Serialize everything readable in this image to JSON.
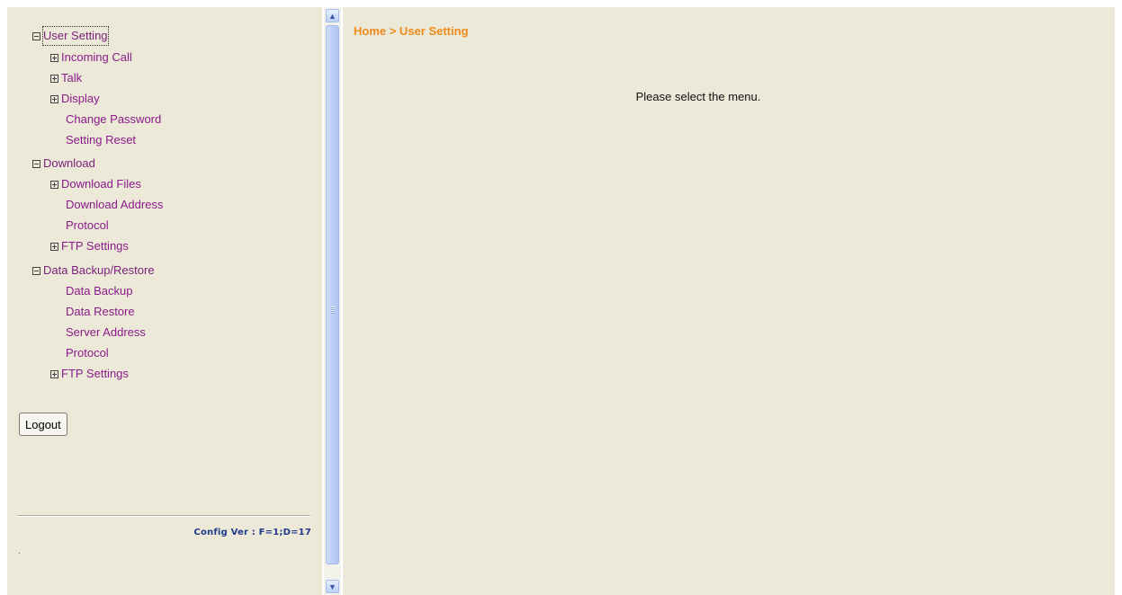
{
  "sidebar": {
    "tree": [
      {
        "label": "User Setting",
        "expander": "minus",
        "level": 0,
        "focused": true
      },
      {
        "label": "Incoming Call",
        "expander": "plus",
        "level": 1
      },
      {
        "label": "Talk",
        "expander": "plus",
        "level": 1
      },
      {
        "label": "Display",
        "expander": "plus",
        "level": 1
      },
      {
        "label": "Change Password",
        "expander": "none",
        "level": 1
      },
      {
        "label": "Setting Reset",
        "expander": "none",
        "level": 1
      },
      {
        "label": "Download",
        "expander": "minus",
        "level": 0
      },
      {
        "label": "Download Files",
        "expander": "plus",
        "level": 1
      },
      {
        "label": "Download Address",
        "expander": "none",
        "level": 1
      },
      {
        "label": "Protocol",
        "expander": "none",
        "level": 1
      },
      {
        "label": "FTP Settings",
        "expander": "plus",
        "level": 1
      },
      {
        "label": "Data Backup/Restore",
        "expander": "minus",
        "level": 0
      },
      {
        "label": "Data Backup",
        "expander": "none",
        "level": 1
      },
      {
        "label": "Data Restore",
        "expander": "none",
        "level": 1
      },
      {
        "label": "Server Address",
        "expander": "none",
        "level": 1
      },
      {
        "label": "Protocol",
        "expander": "none",
        "level": 1
      },
      {
        "label": "FTP Settings",
        "expander": "plus",
        "level": 1
      }
    ],
    "logout_label": "Logout",
    "config_version": "Config Ver : F=1;D=17",
    "footer_dot": "."
  },
  "main": {
    "breadcrumb": "Home > User Setting",
    "message": "Please select the menu."
  },
  "colors": {
    "panel_bg": "#ECE9D8",
    "menu_link": "#8B1A8B",
    "breadcrumb": "#F08A1C",
    "config_text": "#1F3A8A",
    "scrollbar_thumb": "#BCD0F6"
  }
}
